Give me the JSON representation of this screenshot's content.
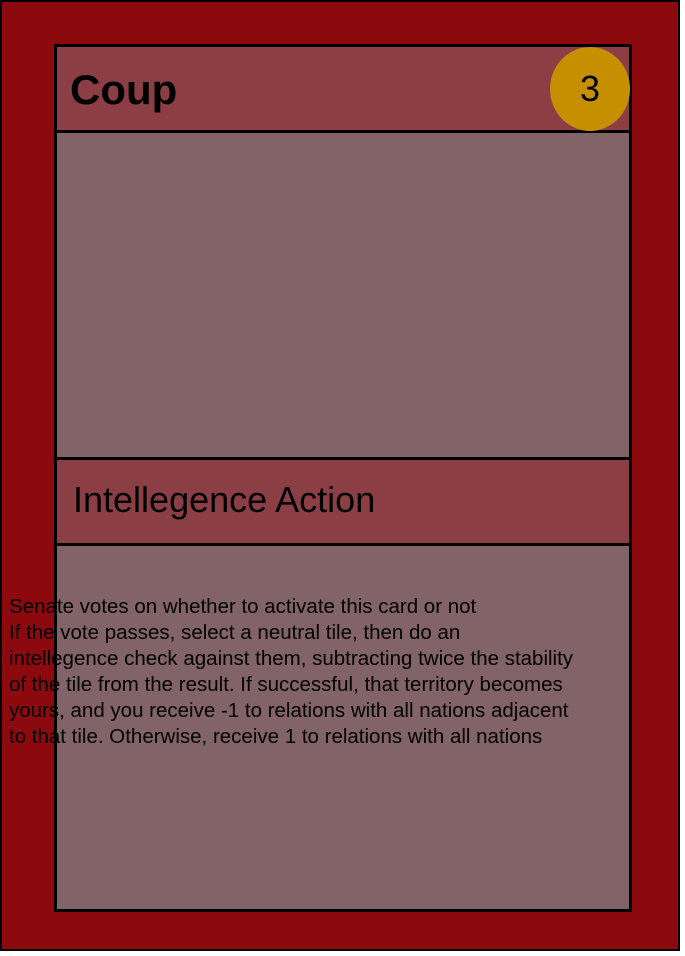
{
  "card": {
    "title": "Coup",
    "cost": "3",
    "type": "Intellegence Action",
    "text": "Senate votes on whether to activate this card or not\nIf the vote passes, select a neutral tile, then do an intellegence check against them, subtracting twice the stability of the tile from the result. If successful, that territory becomes yours, and you receive -1 to relations with all nations adjacent to that tile. Otherwise, receive 1 to relations with all nations",
    "colors": {
      "frame": "#8c0a0e",
      "header": "#8b3f45",
      "panel": "#826367",
      "cost_badge": "#c68f00"
    }
  }
}
